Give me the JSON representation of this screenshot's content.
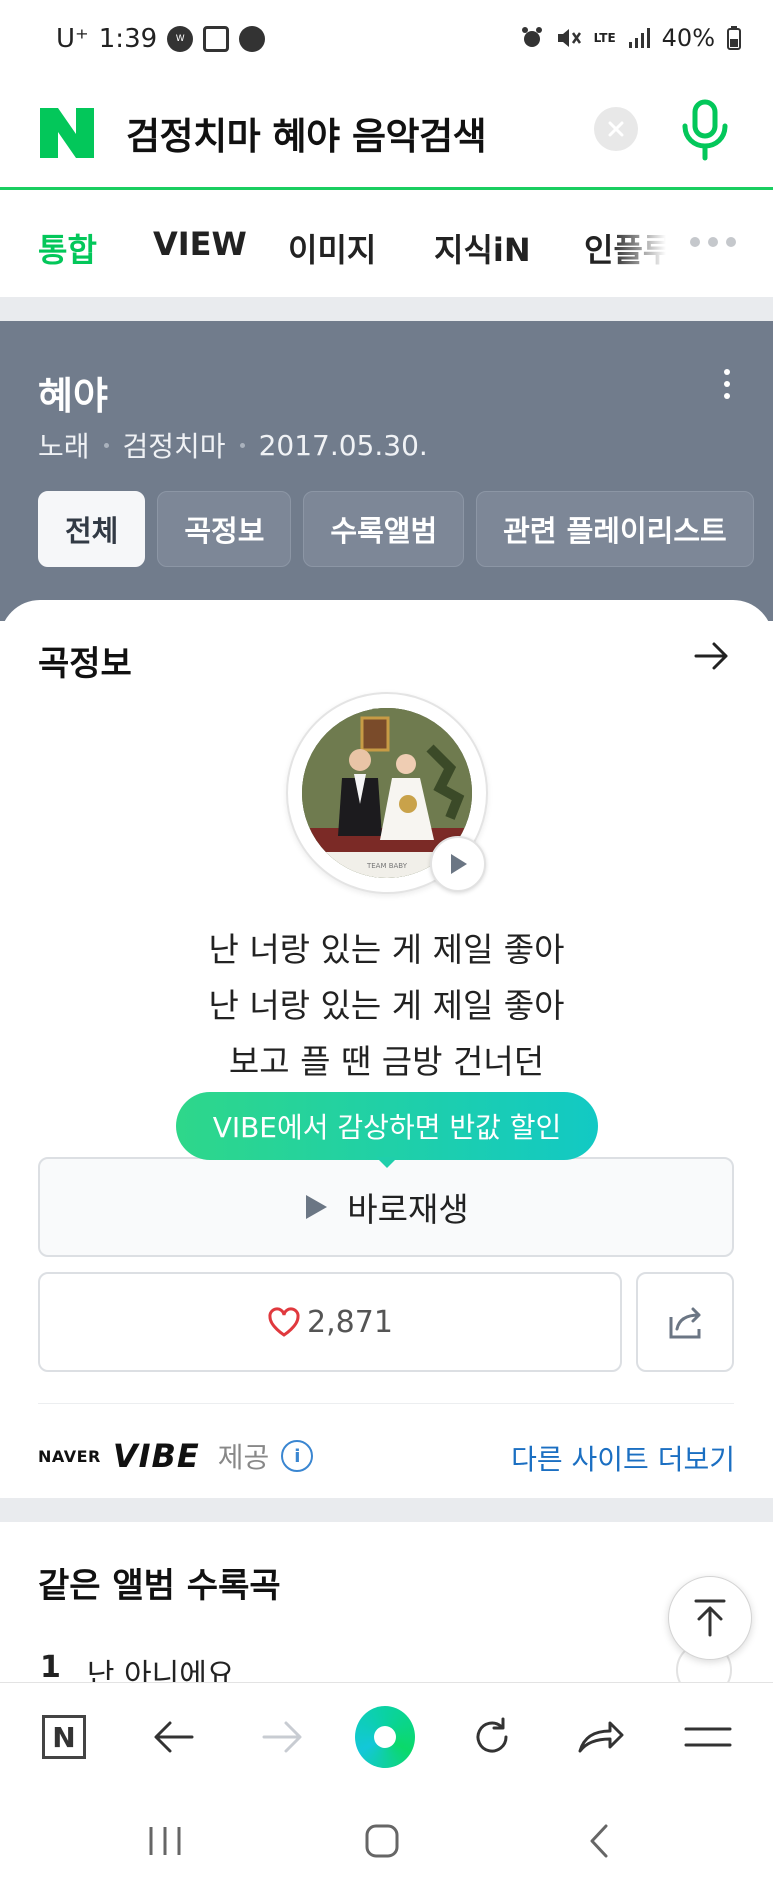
{
  "status_bar": {
    "carrier": "U⁺",
    "time": "1:39",
    "network": "LTE",
    "battery": "40%",
    "icons": [
      "wear-icon",
      "calendar-icon",
      "chat-icon",
      "alarm-icon",
      "mute-icon",
      "signal-icon",
      "battery-icon"
    ]
  },
  "search": {
    "logo": "N",
    "query": "검정치마 혜야 음악검색"
  },
  "tabs": [
    {
      "label": "통합",
      "active": true
    },
    {
      "label": "VIEW",
      "active": false
    },
    {
      "label": "이미지",
      "active": false
    },
    {
      "label": "지식iN",
      "active": false
    },
    {
      "label": "인플루",
      "active": false
    }
  ],
  "song": {
    "title": "혜야",
    "type": "노래",
    "artist": "검정치마",
    "date": "2017.05.30."
  },
  "song_tabs": [
    {
      "label": "전체",
      "active": true
    },
    {
      "label": "곡정보",
      "active": false
    },
    {
      "label": "수록앨범",
      "active": false
    },
    {
      "label": "관련 플레이리스트",
      "active": false
    }
  ],
  "info_card": {
    "title": "곡정보",
    "album_caption": "TEAM BABY",
    "lyrics": [
      "난 너랑 있는 게 제일 좋아",
      "난 너랑 있는 게 제일 좋아",
      "보고 플 땐 금방 건너던"
    ],
    "promo": "VIBE에서 감상하면 반값 할인",
    "play_now": "바로재생",
    "likes": "2,871",
    "provider_naver": "NAVER",
    "provider_vibe": "VIBE",
    "provide_label": "제공",
    "more_sites": "다른 사이트 더보기"
  },
  "album_tracks": {
    "title": "같은 앨범 수록곡",
    "first_track": {
      "num": "1",
      "title": "난 아니에요"
    }
  },
  "colors": {
    "naver_green": "#03c75a",
    "song_header_bg": "#717c8c",
    "link_blue": "#1b6fc2",
    "like_red": "#e0393e"
  }
}
